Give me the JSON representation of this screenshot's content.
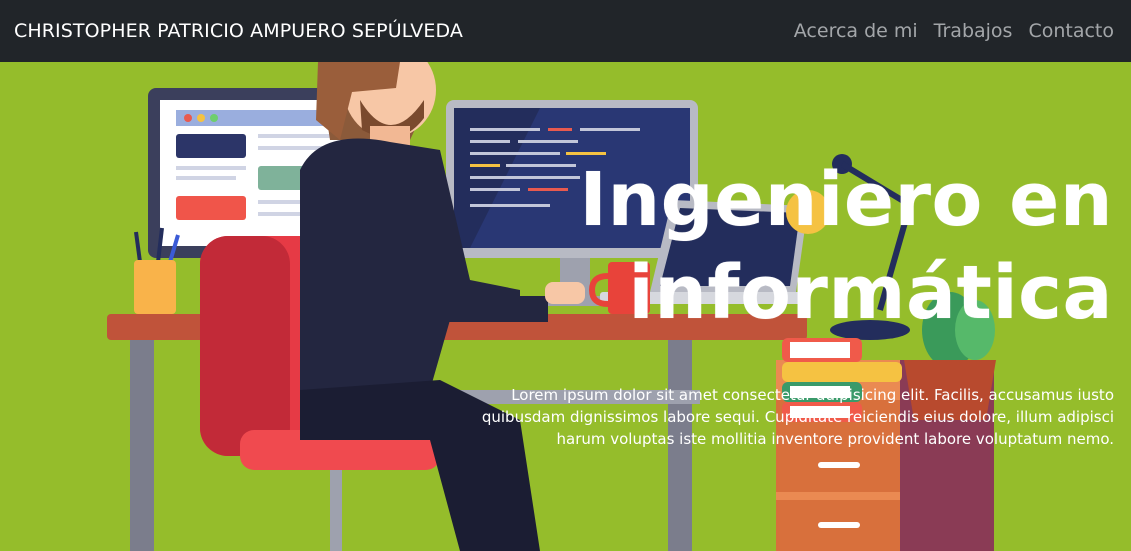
{
  "navbar": {
    "brand": "CHRISTOPHER PATRICIO AMPUERO SEPÚLVEDA",
    "links": [
      "Acerca de mi",
      "Trabajos",
      "Contacto"
    ]
  },
  "hero": {
    "title": "Ingeniero en informática",
    "text": "Lorem ipsum dolor sit amet consectetur adipisicing elit. Facilis, accusamus iusto quibusdam dignissimos labore sequi. Cupiditate reiciendis eius dolore, illum adipisci harum voluptas iste mollitia inventore provident labore voluptatum nemo."
  },
  "colors": {
    "navbar_bg": "#212529",
    "hero_bg": "#95bd2b",
    "nav_link": "#a3a6a9",
    "text": "#ffffff"
  }
}
